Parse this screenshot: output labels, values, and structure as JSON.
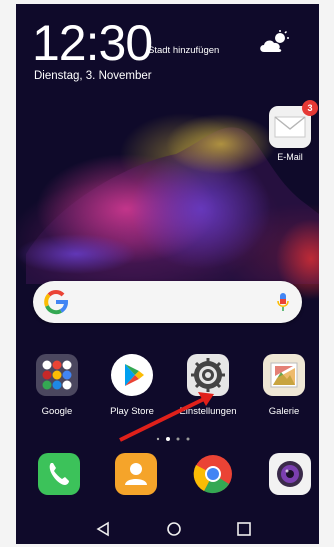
{
  "lockscreen": {
    "time": "12:30",
    "city_placeholder": "Stadt hinzufügen",
    "date": "Dienstag, 3. November"
  },
  "mail": {
    "label": "E-Mail",
    "badge": "3"
  },
  "apps_row": [
    {
      "label": "Google"
    },
    {
      "label": "Play Store"
    },
    {
      "label": "Einstellungen"
    },
    {
      "label": "Galerie"
    }
  ],
  "dock": [
    {
      "name": "phone"
    },
    {
      "name": "contacts"
    },
    {
      "name": "chrome"
    },
    {
      "name": "camera"
    }
  ],
  "colors": {
    "badge": "#e53935",
    "annotation_arrow": "#e0201a",
    "phone": "#3cc25a",
    "contacts": "#f5a42a"
  }
}
